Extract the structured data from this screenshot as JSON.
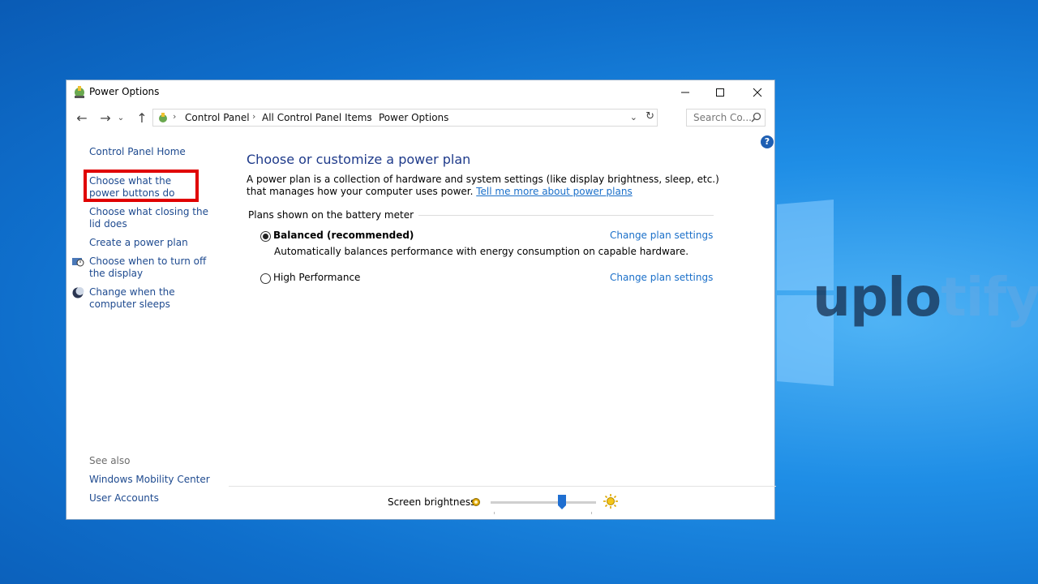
{
  "window": {
    "title": "Power Options"
  },
  "address": {
    "crumbs": [
      "Control Panel",
      "All Control Panel Items",
      "Power Options"
    ],
    "search_placeholder": "Search Co..."
  },
  "sidebar": {
    "home": "Control Panel Home",
    "links": [
      "Choose what the power buttons do",
      "Choose what closing the lid does",
      "Create a power plan",
      "Choose when to turn off the display",
      "Change when the computer sleeps"
    ],
    "see_also_label": "See also",
    "see_also": [
      "Windows Mobility Center",
      "User Accounts"
    ]
  },
  "main": {
    "title": "Choose or customize a power plan",
    "description": "A power plan is a collection of hardware and system settings (like display brightness, sleep, etc.) that manages how your computer uses power.",
    "learn_more": "Tell me more about power plans",
    "group_label": "Plans shown on the battery meter",
    "plans": [
      {
        "name": "Balanced (recommended)",
        "selected": true,
        "description": "Automatically balances performance with energy consumption on capable hardware.",
        "link": "Change plan settings"
      },
      {
        "name": "High Performance",
        "selected": false,
        "link": "Change plan settings"
      }
    ]
  },
  "brightness": {
    "label": "Screen brightness:",
    "level": 0.68
  },
  "watermark": {
    "part1": "uplo",
    "part2": "tify"
  },
  "colors": {
    "link": "#1a6fc9",
    "title": "#1e3a8a",
    "highlight": "#e00000"
  }
}
